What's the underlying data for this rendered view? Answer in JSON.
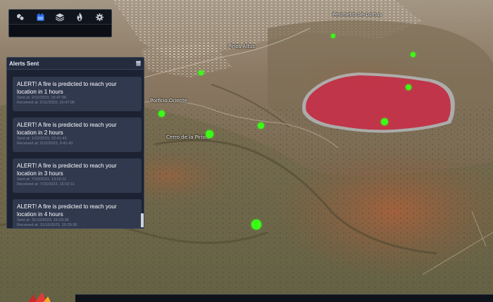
{
  "toolbar": {
    "icons": [
      "layers-group-icon",
      "calendar-icon",
      "stack-layers-icon",
      "flame-icon",
      "gear-icon"
    ],
    "active_index": 1,
    "search_placeholder": ""
  },
  "map": {
    "place_labels": [
      "Cerro de la Piriola",
      "Porfirio Oriente",
      "Pinos Altos",
      "Perimetro de Lomas"
    ],
    "colors": {
      "fire_zone": "#c2283e",
      "fire_zone_outline": "#c9d6e2",
      "marker": "#39ff14"
    }
  },
  "alerts": {
    "title": "Alerts Sent",
    "items": [
      {
        "text": "ALERT! A fire is predicted to reach your location in 1 hours",
        "sent": "Sent at: 2/11/2023, 16:47:06",
        "received": "Received at: 2/11/2023, 16:47:06"
      },
      {
        "text": "ALERT! A fire is predicted to reach your location in 2 hours",
        "sent": "Sent at: 1/12/2023, 22:41:43",
        "received": "Received at: 2/12/2023, 9:41:43"
      },
      {
        "text": "ALERT! A fire is predicted to reach your location in 3 hours",
        "sent": "Sent at: 7/10/2023, 13:02:11",
        "received": "Received at: 7/10/2023, 16:02:11"
      },
      {
        "text": "ALERT! A fire is predicted to reach your location in 4 hours",
        "sent": "Sent at: 31/10/2023, 15:29:36",
        "received": "Received at: 31/10/2023, 15:29:36"
      }
    ]
  }
}
